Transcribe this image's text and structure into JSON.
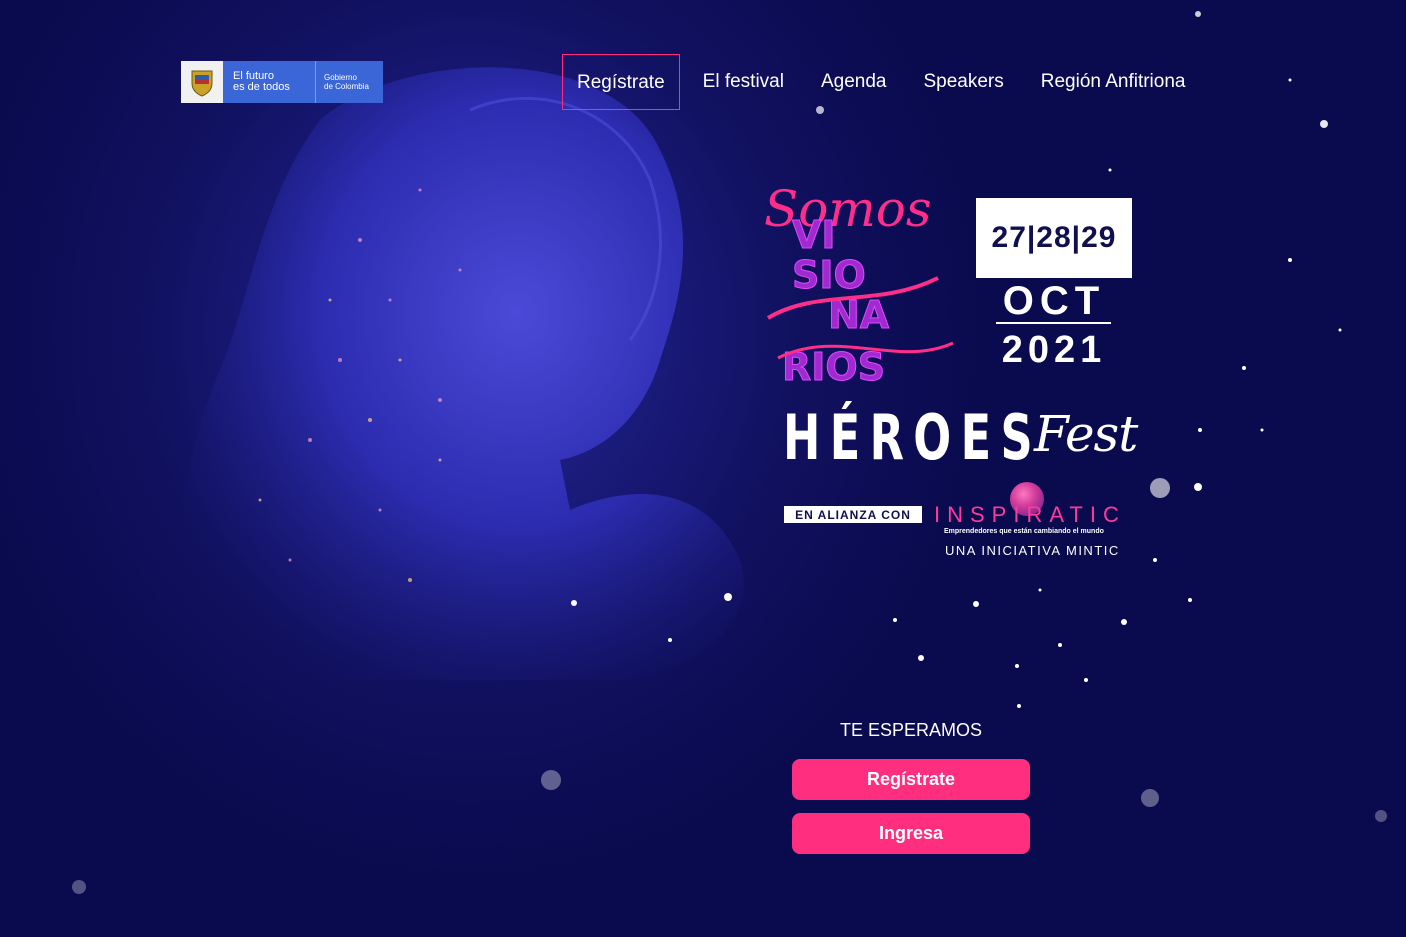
{
  "header": {
    "logo": {
      "line1": "El futuro",
      "line2": "es de todos",
      "gov_line1": "Gobierno",
      "gov_line2": "de Colombia"
    },
    "nav": [
      {
        "label": "Regístrate",
        "active": true
      },
      {
        "label": "El festival",
        "active": false
      },
      {
        "label": "Agenda",
        "active": false
      },
      {
        "label": "Speakers",
        "active": false
      },
      {
        "label": "Región Anfitriona",
        "active": false
      }
    ]
  },
  "event": {
    "somos": "Somos",
    "visionarios": "VISIONARIOS",
    "dates": "27|28|29",
    "month": "OCT",
    "year": "2021",
    "heroes": "HÉROES",
    "fest": "Fest",
    "alliance": "EN ALIANZA CON",
    "partner": "INSPIRATIC",
    "partner_tagline": "Emprendedores que están cambiando el mundo",
    "initiative": "UNA INICIATIVA MINTIC"
  },
  "cta": {
    "prompt": "TE ESPERAMOS",
    "register_button": "Regístrate",
    "login_button": "Ingresa"
  },
  "colors": {
    "background": "#0a0a4e",
    "accent": "#ff2e7e"
  }
}
